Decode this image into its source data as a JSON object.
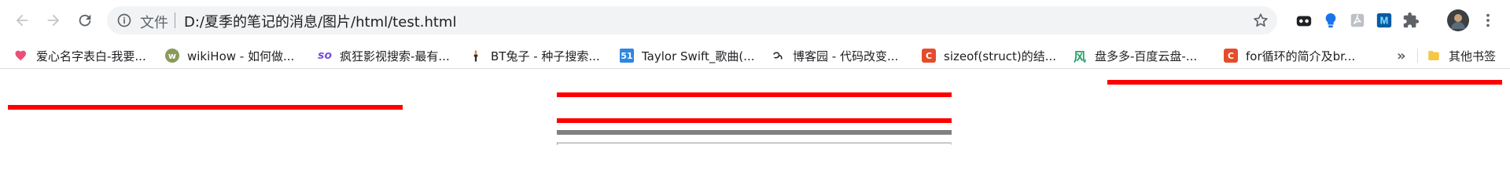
{
  "toolbar": {
    "back_icon": "arrow-left-icon",
    "forward_icon": "arrow-right-icon",
    "reload_icon": "reload-icon"
  },
  "omnibox": {
    "scheme_label": "文件",
    "url": "D:/夏季的笔记的消息/图片/html/test.html",
    "info_icon": "info-icon",
    "star_icon": "star-icon"
  },
  "extensions": [
    {
      "name": "cat-ext-icon",
      "color": "#202124"
    },
    {
      "name": "bulb-ext-icon",
      "color": "#1a73e8"
    },
    {
      "name": "pdf-ext-icon",
      "color": "#9aa0a6"
    },
    {
      "name": "m-ext-icon",
      "color": "#0b5aa3"
    },
    {
      "name": "puzzle-icon",
      "color": "#5f6368"
    },
    {
      "name": "avatar",
      "color": "#3c4043"
    },
    {
      "name": "menu-icon",
      "color": "#5f6368"
    }
  ],
  "bookmarks": [
    {
      "label": "爱心名字表白-我要...",
      "icon": "heart-icon",
      "color": "#e8507a"
    },
    {
      "label": "wikiHow - 如何做...",
      "icon": "wikihow-icon",
      "color": "#8a9a5b"
    },
    {
      "label": "疯狂影视搜索-最有...",
      "icon": "so-icon",
      "color": "#7b4ddc"
    },
    {
      "label": "BT兔子 - 种子搜索...",
      "icon": "torch-icon",
      "color": "#3c2a1a"
    },
    {
      "label": "Taylor Swift_歌曲(...",
      "icon": "51-icon",
      "color": "#2f86e0"
    },
    {
      "label": "博客园 - 代码改变...",
      "icon": "cnblogs-icon",
      "color": "#202124"
    },
    {
      "label": "sizeof(struct)的结...",
      "icon": "csdn-icon",
      "color": "#e44c2c"
    },
    {
      "label": "盘多多-百度云盘-...",
      "icon": "wind-icon",
      "color": "#2aa26c"
    },
    {
      "label": "for循环的简介及br...",
      "icon": "csdn-icon",
      "color": "#e44c2c"
    }
  ],
  "bookmarks_overflow": "»",
  "other_bookmarks": {
    "label": "其他书签",
    "icon": "folder-icon",
    "color": "#f6c744"
  },
  "content": {
    "line_color_red": "#ff0000",
    "line_color_gray": "#808080"
  }
}
